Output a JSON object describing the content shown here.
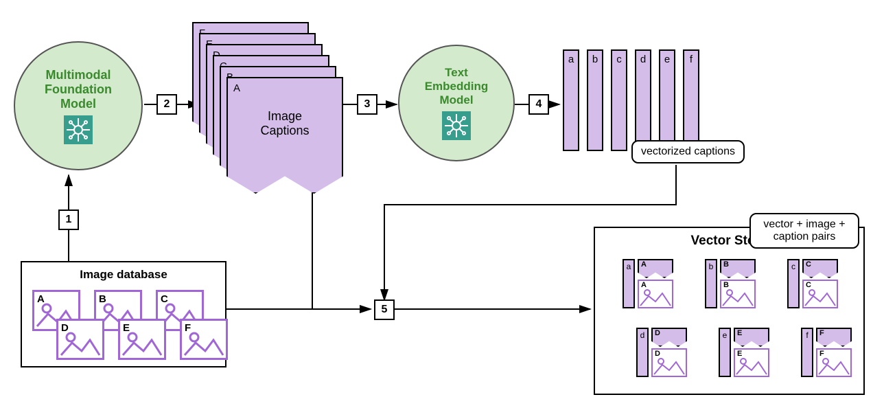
{
  "nodes": {
    "mfm": {
      "title": "Multimodal\nFoundation\nModel"
    },
    "tem": {
      "title": "Text\nEmbedding\nModel"
    },
    "image_db": {
      "title": "Image database",
      "items": [
        "A",
        "B",
        "C",
        "D",
        "E",
        "F"
      ]
    },
    "captions": {
      "main": "Image\nCaptions",
      "stack": [
        "F",
        "E",
        "D",
        "C",
        "B",
        "A"
      ]
    },
    "vectors": {
      "bars": [
        "a",
        "b",
        "c",
        "d",
        "e",
        "f"
      ],
      "label": "vectorized captions"
    },
    "vector_store": {
      "title": "Vector Store",
      "label": "vector + image + caption pairs",
      "items": [
        {
          "bar": "a",
          "cap": "A",
          "img": "A"
        },
        {
          "bar": "b",
          "cap": "B",
          "img": "B"
        },
        {
          "bar": "c",
          "cap": "C",
          "img": "C"
        },
        {
          "bar": "d",
          "cap": "D",
          "img": "D"
        },
        {
          "bar": "e",
          "cap": "E",
          "img": "E"
        },
        {
          "bar": "f",
          "cap": "F",
          "img": "F"
        }
      ]
    }
  },
  "steps": {
    "s1": "1",
    "s2": "2",
    "s3": "3",
    "s4": "4",
    "s5": "5"
  }
}
